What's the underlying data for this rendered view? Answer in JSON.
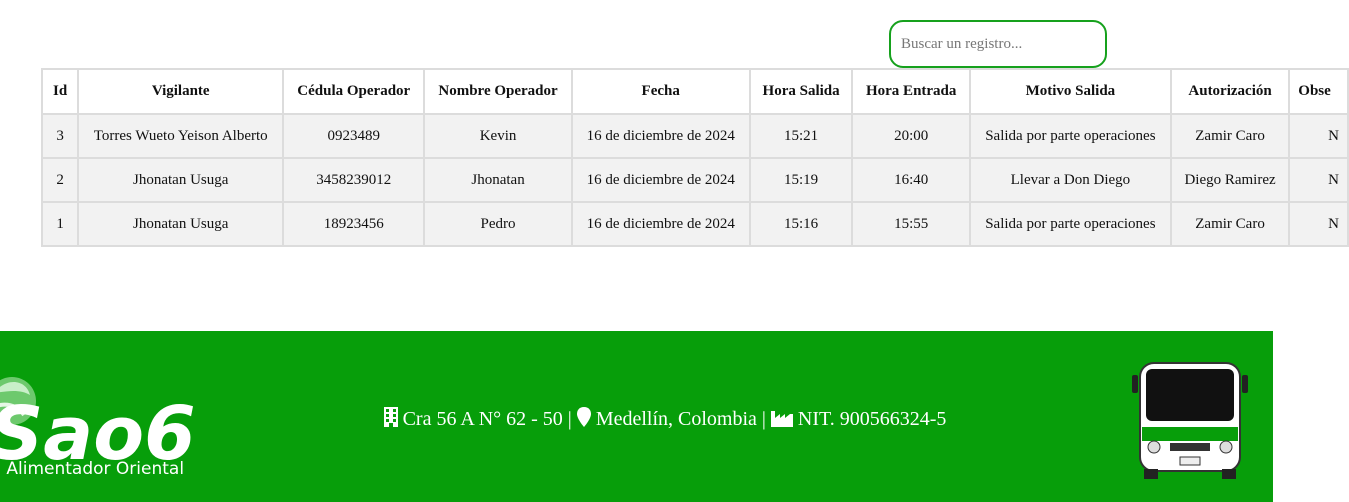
{
  "search": {
    "placeholder": "Buscar un registro..."
  },
  "table": {
    "headers": [
      "Id",
      "Vigilante",
      "Cédula Operador",
      "Nombre Operador",
      "Fecha",
      "Hora Salida",
      "Hora Entrada",
      "Motivo Salida",
      "Autorización",
      "Obse"
    ],
    "rows": [
      [
        "3",
        "Torres Wueto Yeison Alberto",
        "0923489",
        "Kevin",
        "16 de diciembre de 2024",
        "15:21",
        "20:00",
        "Salida por parte operaciones",
        "Zamir Caro",
        "N"
      ],
      [
        "2",
        "Jhonatan Usuga",
        "3458239012",
        "Jhonatan",
        "16 de diciembre de 2024",
        "15:19",
        "16:40",
        "Llevar a Don Diego",
        "Diego Ramirez",
        "N"
      ],
      [
        "1",
        "Jhonatan Usuga",
        "18923456",
        "Pedro",
        "16 de diciembre de 2024",
        "15:16",
        "15:55",
        "Salida por parte operaciones",
        "Zamir Caro",
        "N"
      ]
    ]
  },
  "footer": {
    "logo_text": "Sao6",
    "brand_text": "ma Alimentador Oriental",
    "address": "Cra 56 A N° 62 - 50",
    "separator": "|",
    "city": "Medellín, Colombia",
    "nit": "NIT. 900566324-5",
    "background_color": "#079e0a",
    "icons": [
      "building-icon",
      "location-pin-icon",
      "industry-icon",
      "bus-image"
    ]
  }
}
